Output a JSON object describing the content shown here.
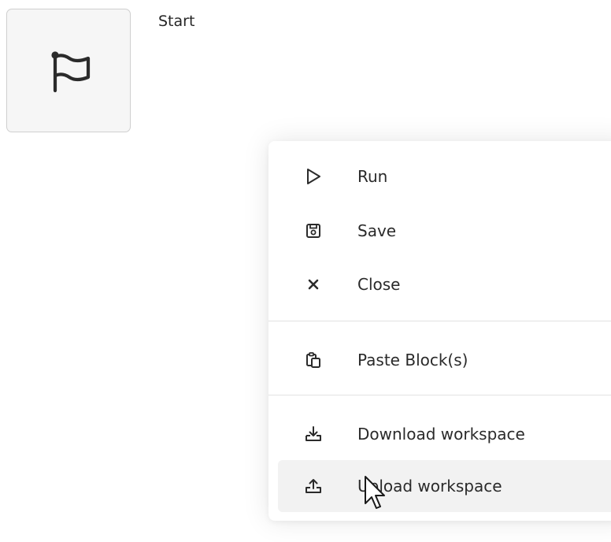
{
  "start_block": {
    "label": "Start",
    "icon": "flag-icon"
  },
  "context_menu": {
    "items": [
      {
        "label": "Run",
        "icon": "play-icon"
      },
      {
        "label": "Save",
        "icon": "save-icon"
      },
      {
        "label": "Close",
        "icon": "close-icon"
      },
      {
        "label": "Paste Block(s)",
        "icon": "paste-icon"
      },
      {
        "label": "Download workspace",
        "icon": "download-icon"
      },
      {
        "label": "Upload workspace",
        "icon": "upload-icon"
      }
    ],
    "hovered_item": "Upload workspace"
  },
  "cursor": {
    "icon": "pointer-cursor-icon"
  }
}
